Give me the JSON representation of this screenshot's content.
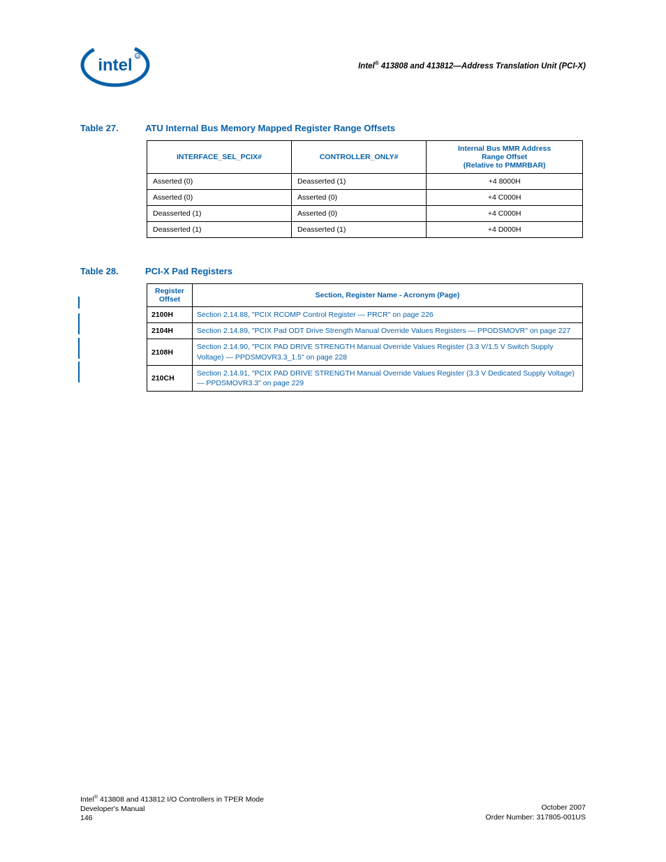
{
  "header": {
    "title_prefix": "Intel",
    "title_rest": " 413808 and 413812—Address Translation Unit (PCI-X)"
  },
  "table27": {
    "label": "Table 27.",
    "title": "ATU Internal Bus Memory Mapped Register Range Offsets",
    "headers": {
      "col1": "INTERFACE_SEL_PCIX#",
      "col2": "CONTROLLER_ONLY#",
      "col3_l1": "Internal Bus MMR Address",
      "col3_l2": "Range Offset",
      "col3_l3": "(Relative to PMMRBAR)"
    },
    "rows": [
      {
        "c1": "Asserted (0)",
        "c2": "Deasserted (1)",
        "c3": "+4 8000H"
      },
      {
        "c1": "Asserted (0)",
        "c2": "Asserted (0)",
        "c3": "+4 C000H"
      },
      {
        "c1": "Deasserted (1)",
        "c2": "Asserted (0)",
        "c3": "+4 C000H"
      },
      {
        "c1": "Deasserted (1)",
        "c2": "Deasserted (1)",
        "c3": "+4 D000H"
      }
    ]
  },
  "table28": {
    "label": "Table 28.",
    "title": "PCI-X Pad Registers",
    "headers": {
      "col1_l1": "Register",
      "col1_l2": "Offset",
      "col2": "Section, Register Name - Acronym (Page)"
    },
    "rows": [
      {
        "offset": "2100H",
        "text": "Section 2.14.88, \"PCIX RCOMP Control Register — PRCR\" on page 226"
      },
      {
        "offset": "2104H",
        "text": "Section 2.14.89, \"PCIX Pad ODT Drive Strength Manual Override Values Registers — PPODSMOVR\" on page 227"
      },
      {
        "offset": "2108H",
        "text": "Section 2.14.90, \"PCIX PAD DRIVE STRENGTH Manual Override Values Register (3.3 V/1.5 V Switch Supply Voltage) — PPDSMOVR3.3_1.5\" on page 228"
      },
      {
        "offset": "210CH",
        "text": "Section 2.14.91, \"PCIX PAD DRIVE STRENGTH Manual Override Values Register (3.3 V Dedicated Supply Voltage) — PPDSMOVR3.3\" on page 229"
      }
    ]
  },
  "footer": {
    "left_l1_pre": "Intel",
    "left_l1_post": " 413808 and 413812 I/O Controllers in TPER Mode",
    "left_l2": "Developer's Manual",
    "left_l3": "146",
    "right_l1": "October 2007",
    "right_l2": "Order Number: 317805-001US"
  }
}
